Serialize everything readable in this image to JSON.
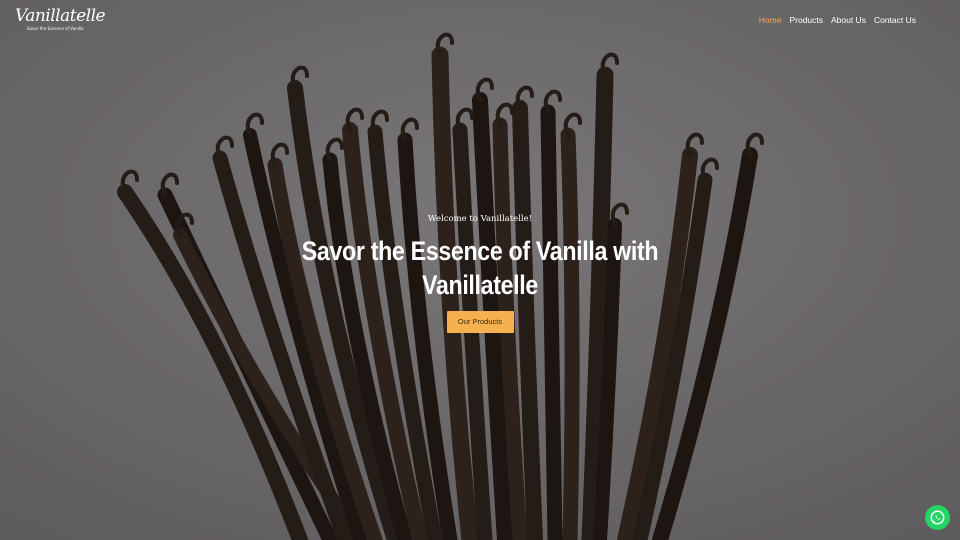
{
  "brand": {
    "logo_text": "Vanillatelle",
    "tagline": "Savor the Essence of Vanilla"
  },
  "nav": {
    "items": [
      {
        "label": "Home",
        "active": true
      },
      {
        "label": "Products",
        "active": false
      },
      {
        "label": "About Us",
        "active": false
      },
      {
        "label": "Contact Us",
        "active": false
      }
    ]
  },
  "hero": {
    "welcome": "Welcome to Vanillatelle!",
    "headline": "Savor the Essence of Vanilla with Vanillatelle",
    "cta_label": "Our Products"
  },
  "colors": {
    "accent": "#f5b150",
    "nav_active": "#f0a94a",
    "background": "#7a7778",
    "whatsapp": "#25d366"
  },
  "icons": {
    "chat": "whatsapp-icon"
  }
}
